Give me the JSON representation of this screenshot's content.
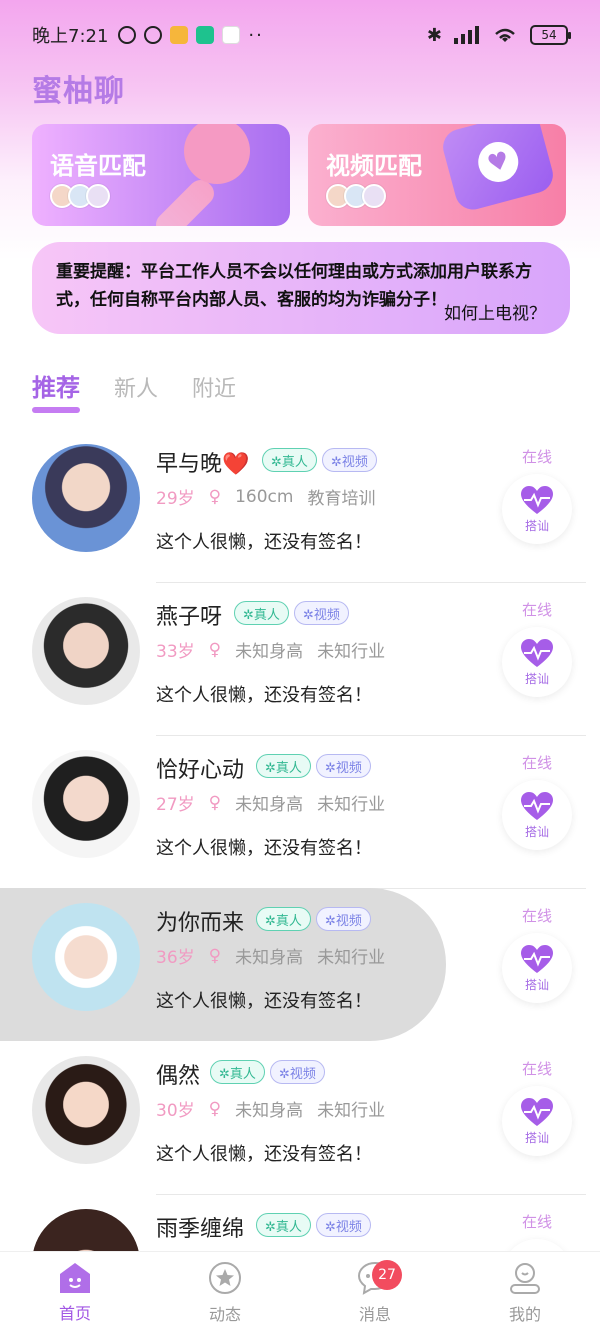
{
  "status": {
    "time": "晚上7:21",
    "battery": "54"
  },
  "app": {
    "title": "蜜柚聊"
  },
  "match": {
    "voice": "语音匹配",
    "video": "视频匹配"
  },
  "notice": {
    "text": "重要提醒：平台工作人员不会以任何理由或方式添加用户联系方式，任何自称平台内部人员、客服的均为诈骗分子！",
    "link": "如何上电视？"
  },
  "tabs": [
    "推荐",
    "新人",
    "附近"
  ],
  "users": [
    {
      "name": "早与晚❤️",
      "age": "29岁",
      "height": "160cm",
      "job": "教育培训",
      "sign": "这个人很懒，还没有签名！",
      "online": "在线",
      "real": "✲真人",
      "video": "✲视频",
      "action": "搭讪"
    },
    {
      "name": "燕子呀",
      "age": "33岁",
      "height": "未知身高",
      "job": "未知行业",
      "sign": "这个人很懒，还没有签名！",
      "online": "在线",
      "real": "✲真人",
      "video": "✲视频",
      "action": "搭讪"
    },
    {
      "name": "恰好心动",
      "age": "27岁",
      "height": "未知身高",
      "job": "未知行业",
      "sign": "这个人很懒，还没有签名！",
      "online": "在线",
      "real": "✲真人",
      "video": "✲视频",
      "action": "搭讪"
    },
    {
      "name": "为你而来",
      "age": "36岁",
      "height": "未知身高",
      "job": "未知行业",
      "sign": "这个人很懒，还没有签名！",
      "online": "在线",
      "real": "✲真人",
      "video": "✲视频",
      "action": "搭讪"
    },
    {
      "name": "偶然",
      "age": "30岁",
      "height": "未知身高",
      "job": "未知行业",
      "sign": "这个人很懒，还没有签名！",
      "online": "在线",
      "real": "✲真人",
      "video": "✲视频",
      "action": "搭讪"
    },
    {
      "name": "雨季缠绵",
      "online": "在线",
      "real": "✲真人",
      "video": "✲视频"
    }
  ],
  "nav": {
    "home": "首页",
    "moments": "动态",
    "messages": "消息",
    "mine": "我的",
    "message_count": "27"
  }
}
